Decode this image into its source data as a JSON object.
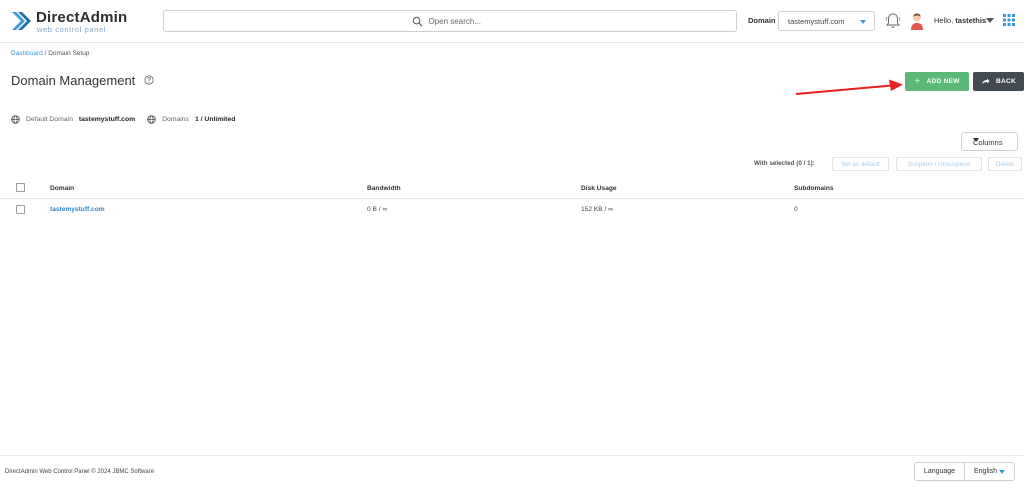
{
  "header": {
    "logo_title": "DirectAdmin",
    "logo_subtitle": "web control panel",
    "search_placeholder": "Open search...",
    "domain_label": "Domain",
    "domain_selected": "tastemystuff.com",
    "hello_prefix": "Hello,",
    "username": "tastethis"
  },
  "breadcrumb": {
    "root": "Dashboard",
    "separator": " / ",
    "current": "Domain Setup"
  },
  "page": {
    "title": "Domain Management",
    "add_label": "ADD NEW",
    "back_label": "BACK"
  },
  "info": {
    "default_domain_label": "Default Domain",
    "default_domain_value": "tastemystuff.com",
    "domains_label": "Domains",
    "domains_value": "1 / Unlimited"
  },
  "toolbar": {
    "columns_label": "Columns",
    "with_selected": "With selected (0 / 1):",
    "set_default": "Set as default",
    "suspend": "Suspend / Unsuspend",
    "delete": "Delete"
  },
  "table": {
    "headers": [
      "Domain",
      "Bandwidth",
      "Disk Usage",
      "Subdomains"
    ],
    "rows": [
      {
        "domain": "tastemystuff.com",
        "bandwidth": "0 B / ∞",
        "disk": "152 KB / ∞",
        "subdomains": "0"
      }
    ]
  },
  "footer": {
    "copyright": "DirectAdmin Web Control Panel © 2024 JBMC Software",
    "language_label": "Language",
    "language_value": "English"
  },
  "colors": {
    "accent": "#3a9ad9",
    "add_button": "#5cb878",
    "back_button": "#444a52",
    "annotation_arrow": "#e8201f"
  },
  "icons": [
    "logo-mark-icon",
    "search-icon",
    "bell-icon",
    "avatar-icon",
    "apps-grid-icon",
    "help-icon",
    "plus-icon",
    "back-arrow-icon",
    "globe-icon",
    "annotation-arrow-icon"
  ]
}
